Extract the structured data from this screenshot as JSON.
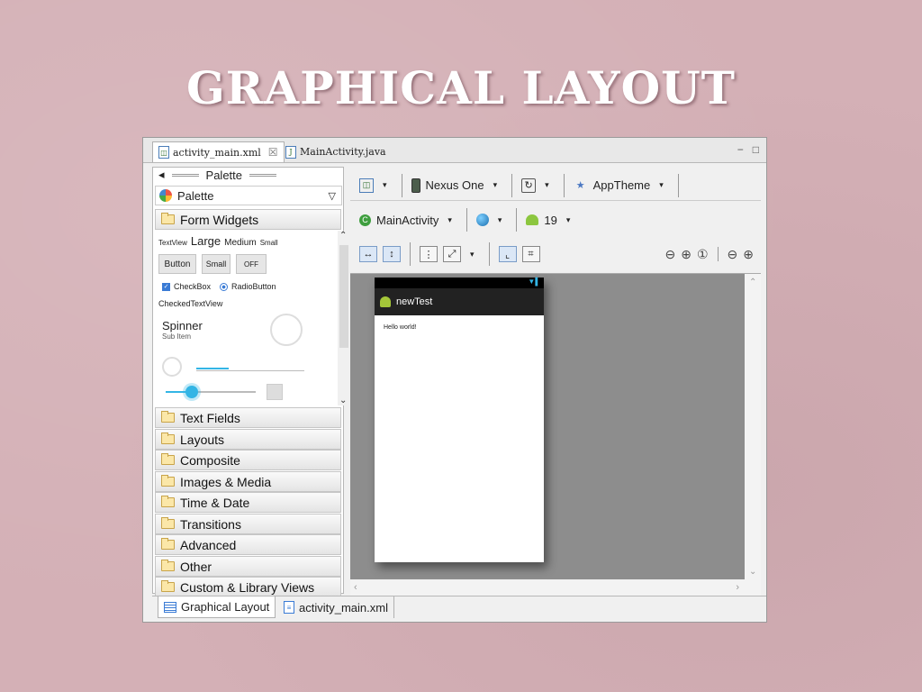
{
  "slide": {
    "title": "GRAPHICAL LAYOUT"
  },
  "editor_tabs": [
    {
      "label": "activity_main.xml",
      "close": "☒",
      "icon": "xml-file-icon"
    },
    {
      "label": "MainActivity.java",
      "icon": "java-file-icon"
    }
  ],
  "window_controls": {
    "minimize": "−",
    "maximize": "□"
  },
  "palette": {
    "header": "Palette",
    "back_arrow": "◂",
    "selector_label": "Palette",
    "selector_chevron": "▽",
    "expanded_category": "Form Widgets",
    "widgets": {
      "textview": "TextView",
      "large": "Large",
      "medium": "Medium",
      "small_text": "Small",
      "button": "Button",
      "small_button": "Small",
      "toggle": "OFF",
      "checkbox": "CheckBox",
      "radiobutton": "RadioButton",
      "checkedtextview": "CheckedTextView",
      "spinner": "Spinner",
      "spinner_sub": "Sub Item"
    },
    "categories": [
      "Text Fields",
      "Layouts",
      "Composite",
      "Images & Media",
      "Time & Date",
      "Transitions",
      "Advanced",
      "Other",
      "Custom & Library Views"
    ]
  },
  "toolbar": {
    "device": "Nexus One",
    "theme": "AppTheme",
    "activity": "MainActivity",
    "api_level": "19",
    "dropdown_glyph": "▾"
  },
  "preview": {
    "app_name": "newTest",
    "content_text": "Hello world!",
    "status_icons": "▼▌"
  },
  "bottom_tabs": [
    {
      "label": "Graphical Layout",
      "active": true
    },
    {
      "label": "activity_main.xml",
      "active": false
    }
  ],
  "colors": {
    "slide_bg": "#d4b0b6",
    "holo_blue": "#33b5e5",
    "android_green": "#a4c639"
  }
}
